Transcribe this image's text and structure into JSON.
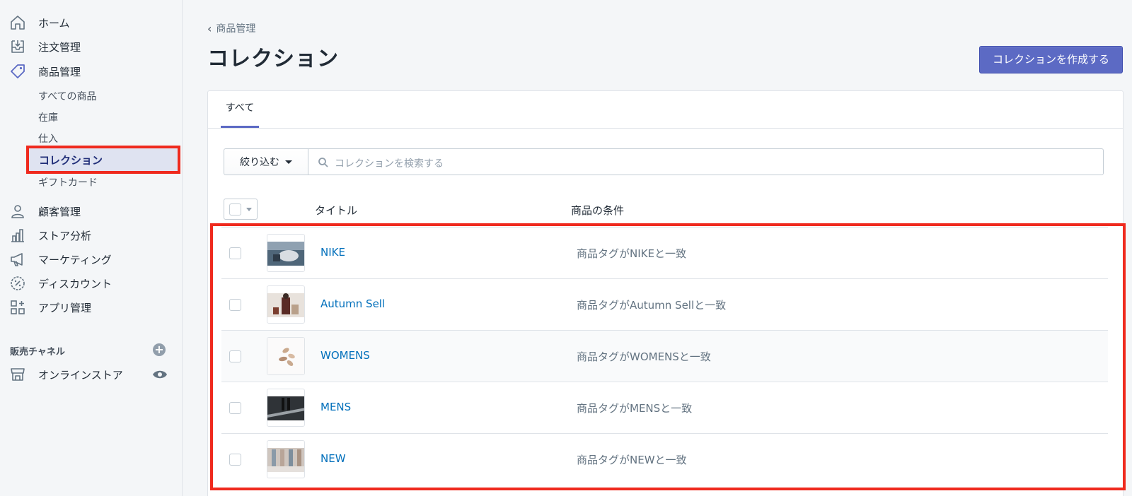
{
  "sidebar": {
    "items": [
      {
        "label": "ホーム",
        "icon": "home-icon"
      },
      {
        "label": "注文管理",
        "icon": "orders-icon"
      },
      {
        "label": "商品管理",
        "icon": "tag-icon"
      },
      {
        "label": "顧客管理",
        "icon": "person-icon"
      },
      {
        "label": "ストア分析",
        "icon": "bar-chart-icon"
      },
      {
        "label": "マーケティング",
        "icon": "megaphone-icon"
      },
      {
        "label": "ディスカウント",
        "icon": "discount-icon"
      },
      {
        "label": "アプリ管理",
        "icon": "apps-icon"
      }
    ],
    "product_sub_items": [
      "すべての商品",
      "在庫",
      "仕入",
      "コレクション",
      "ギフトカード"
    ],
    "active_sub_item": "コレクション",
    "sales_channels_title": "販売チャネル",
    "online_store_label": "オンラインストア"
  },
  "header": {
    "breadcrumb": "商品管理",
    "title": "コレクション",
    "create_button": "コレクションを作成する"
  },
  "tabs": [
    "すべて"
  ],
  "filter": {
    "button_label": "絞り込む",
    "search_placeholder": "コレクションを検索する"
  },
  "table": {
    "columns": [
      "タイトル",
      "商品の条件"
    ],
    "rows": [
      {
        "title": "NIKE",
        "condition": "商品タグがNIKEと一致"
      },
      {
        "title": "Autumn Sell",
        "condition": "商品タグがAutumn Sellと一致"
      },
      {
        "title": "WOMENS",
        "condition": "商品タグがWOMENSと一致"
      },
      {
        "title": "MENS",
        "condition": "商品タグがMENSと一致"
      },
      {
        "title": "NEW",
        "condition": "商品タグがNEWと一致"
      }
    ]
  },
  "colors": {
    "accent": "#5c6ac4",
    "link": "#006fbb",
    "highlight": "#ef2a1e"
  }
}
